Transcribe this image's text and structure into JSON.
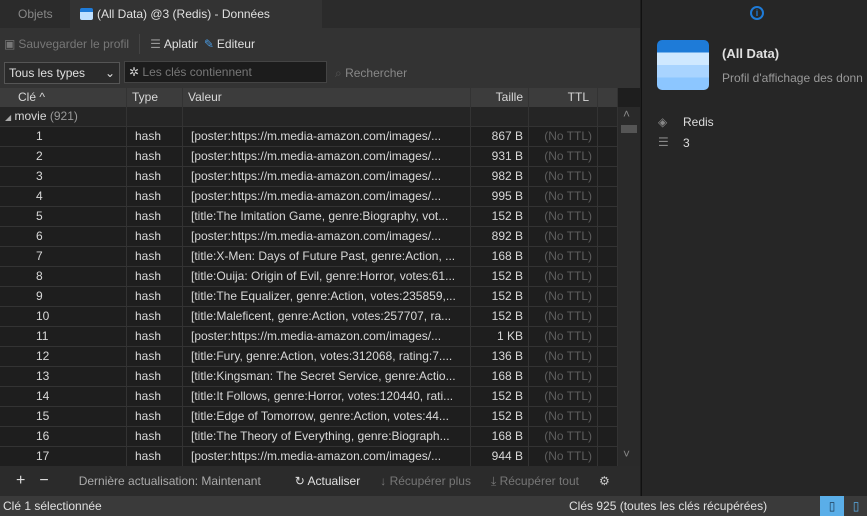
{
  "tabs": [
    {
      "label": "Objets"
    },
    {
      "label": "(All Data) @3 (Redis) - Données"
    }
  ],
  "toolbar": {
    "save_profile": "Sauvegarder le profil",
    "flatten": "Aplatir",
    "editor": "Editeur"
  },
  "filter": {
    "type_select": "Tous les types",
    "search_placeholder": "Les clés contiennent",
    "search_button": "Rechercher"
  },
  "columns": [
    "Clé",
    "Type",
    "Valeur",
    "Taille",
    "TTL"
  ],
  "group": {
    "name": "movie",
    "count": "(921)"
  },
  "rows": [
    {
      "key": "1",
      "type": "hash",
      "value": "[poster:https://m.media-amazon.com/images/...",
      "size": "867 B",
      "ttl": "(No TTL)"
    },
    {
      "key": "2",
      "type": "hash",
      "value": "[poster:https://m.media-amazon.com/images/...",
      "size": "931 B",
      "ttl": "(No TTL)"
    },
    {
      "key": "3",
      "type": "hash",
      "value": "[poster:https://m.media-amazon.com/images/...",
      "size": "982 B",
      "ttl": "(No TTL)"
    },
    {
      "key": "4",
      "type": "hash",
      "value": "[poster:https://m.media-amazon.com/images/...",
      "size": "995 B",
      "ttl": "(No TTL)"
    },
    {
      "key": "5",
      "type": "hash",
      "value": "[title:The Imitation Game, genre:Biography, vot...",
      "size": "152 B",
      "ttl": "(No TTL)"
    },
    {
      "key": "6",
      "type": "hash",
      "value": "[poster:https://m.media-amazon.com/images/...",
      "size": "892 B",
      "ttl": "(No TTL)"
    },
    {
      "key": "7",
      "type": "hash",
      "value": "[title:X-Men: Days of Future Past, genre:Action, ...",
      "size": "168 B",
      "ttl": "(No TTL)"
    },
    {
      "key": "8",
      "type": "hash",
      "value": "[title:Ouija: Origin of Evil, genre:Horror, votes:61...",
      "size": "152 B",
      "ttl": "(No TTL)"
    },
    {
      "key": "9",
      "type": "hash",
      "value": "[title:The Equalizer, genre:Action, votes:235859,...",
      "size": "152 B",
      "ttl": "(No TTL)"
    },
    {
      "key": "10",
      "type": "hash",
      "value": "[title:Maleficent, genre:Action, votes:257707, ra...",
      "size": "152 B",
      "ttl": "(No TTL)"
    },
    {
      "key": "11",
      "type": "hash",
      "value": "[poster:https://m.media-amazon.com/images/...",
      "size": "1 KB",
      "ttl": "(No TTL)"
    },
    {
      "key": "12",
      "type": "hash",
      "value": "[title:Fury, genre:Action, votes:312068, rating:7....",
      "size": "136 B",
      "ttl": "(No TTL)"
    },
    {
      "key": "13",
      "type": "hash",
      "value": "[title:Kingsman: The Secret Service, genre:Actio...",
      "size": "168 B",
      "ttl": "(No TTL)"
    },
    {
      "key": "14",
      "type": "hash",
      "value": "[title:It Follows, genre:Horror, votes:120440, rati...",
      "size": "152 B",
      "ttl": "(No TTL)"
    },
    {
      "key": "15",
      "type": "hash",
      "value": "[title:Edge of Tomorrow, genre:Action, votes:44...",
      "size": "152 B",
      "ttl": "(No TTL)"
    },
    {
      "key": "16",
      "type": "hash",
      "value": "[title:The Theory of Everything, genre:Biograph...",
      "size": "168 B",
      "ttl": "(No TTL)"
    },
    {
      "key": "17",
      "type": "hash",
      "value": "[poster:https://m.media-amazon.com/images/...",
      "size": "944 B",
      "ttl": "(No TTL)"
    }
  ],
  "bottom": {
    "add": "+",
    "remove": "−",
    "last_refresh": "Dernière actualisation: Maintenant",
    "refresh": "Actualiser",
    "fetch_more": "Récupérer plus",
    "fetch_all": "Récupérer tout"
  },
  "status": {
    "left": "Clé 1 sélectionnée",
    "right": "Clés 925 (toutes les clés récupérées)"
  },
  "panel": {
    "title": "(All Data)",
    "subtitle": "Profil d'affichage des donn",
    "server": "Redis",
    "db": "3"
  },
  "colors": {
    "accent": "#1e7bd8",
    "status_active": "#5aaee8"
  }
}
